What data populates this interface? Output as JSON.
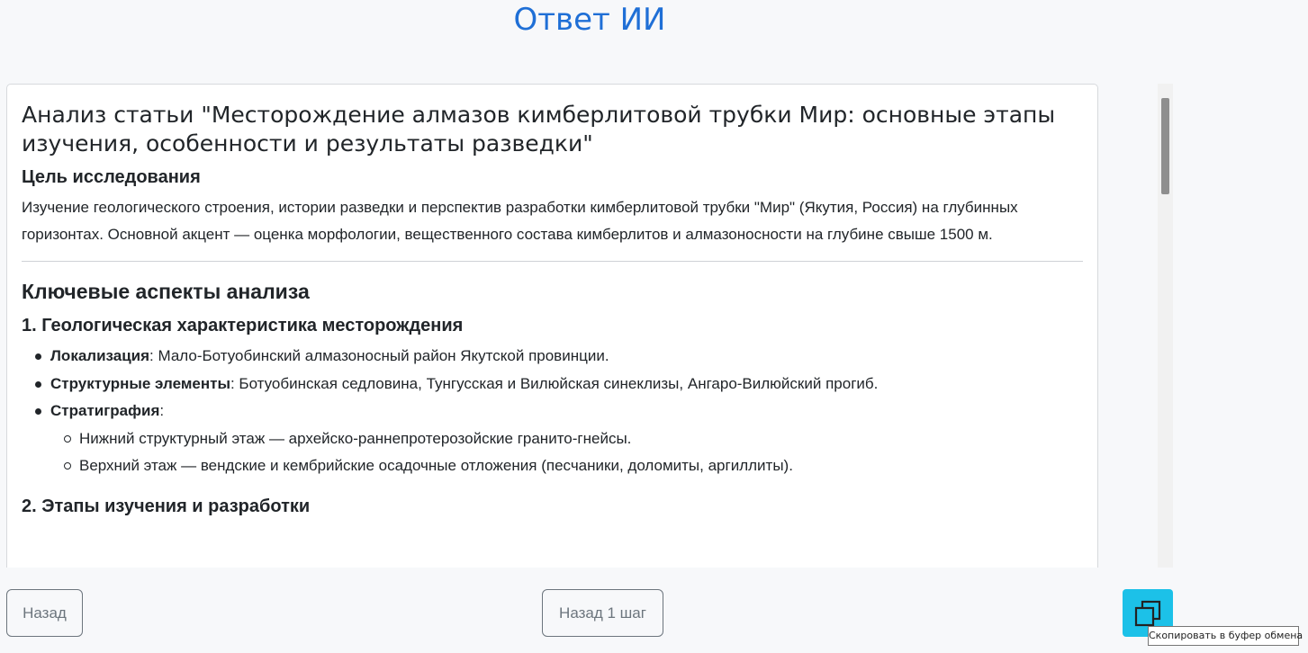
{
  "header": {
    "title": "Ответ ИИ"
  },
  "article": {
    "title": "Анализ статьи \"Месторождение алмазов кимберлитовой трубки Мир: основные этапы изучения, особенности и результаты разведки\"",
    "goal_heading": "Цель исследования",
    "goal_text": "Изучение геологического строения, истории разведки и перспектив разработки кимберлитовой трубки \"Мир\" (Якутия, Россия) на глубинных горизонтах. Основной акцент — оценка морфологии, вещественного состава кимберлитов и алмазоносности на глубине свыше 1500 м.",
    "key_aspects_heading": "Ключевые аспекты анализа",
    "section1": {
      "heading": "1. Геологическая характеристика месторождения",
      "items": [
        {
          "label": "Локализация",
          "text": ": Мало-Ботуобинский алмазоносный район Якутской провинции."
        },
        {
          "label": "Структурные элементы",
          "text": ": Ботуобинская седловина, Тунгусская и Вилюйская синеклизы, Ангаро-Вилюйский прогиб."
        },
        {
          "label": "Стратиграфия",
          "text": ":"
        }
      ],
      "subitems": [
        "Нижний структурный этаж — архейско-раннепротерозойские гранито-гнейсы.",
        "Верхний этаж — вендские и кембрийские осадочные отложения (песчаники, доломиты, аргиллиты)."
      ]
    },
    "section2": {
      "heading": "2. Этапы изучения и разработки"
    }
  },
  "buttons": {
    "back": "Назад",
    "back_one_step": "Назад 1 шаг"
  },
  "copy": {
    "icon": "copy-icon",
    "tooltip": "Скопировать в буфер обмена"
  }
}
